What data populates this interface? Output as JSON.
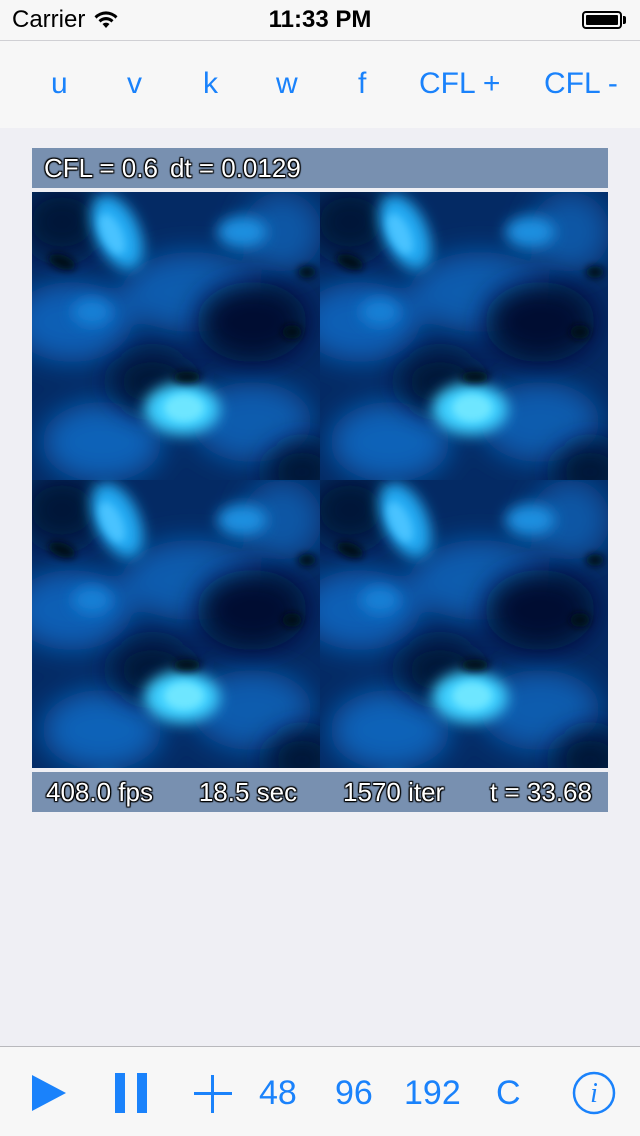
{
  "status_bar": {
    "carrier": "Carrier",
    "time": "11:33 PM"
  },
  "top_toolbar": {
    "u": "u",
    "v": "v",
    "k": "k",
    "w": "w",
    "f": "f",
    "cfl_plus": "CFL +",
    "cfl_minus": "CFL -"
  },
  "sim_header": {
    "cfl": "CFL = 0.6",
    "dt": "dt = 0.0129"
  },
  "sim_footer": {
    "fps": "408.0 fps",
    "sec": "18.5 sec",
    "iter": "1570 iter",
    "t": "t = 33.68"
  },
  "bottom_toolbar": {
    "play_icon": "play-icon",
    "pause_icon": "pause-icon",
    "add_icon": "plus-icon",
    "res_48": "48",
    "res_96": "96",
    "res_192": "192",
    "c": "C",
    "info_icon": "info-icon"
  },
  "colors": {
    "accent": "#1a82fb",
    "panel": "#7890b0",
    "background": "#efeff4",
    "sim_dark": "#02204a",
    "sim_bright": "#3cd8ff"
  }
}
